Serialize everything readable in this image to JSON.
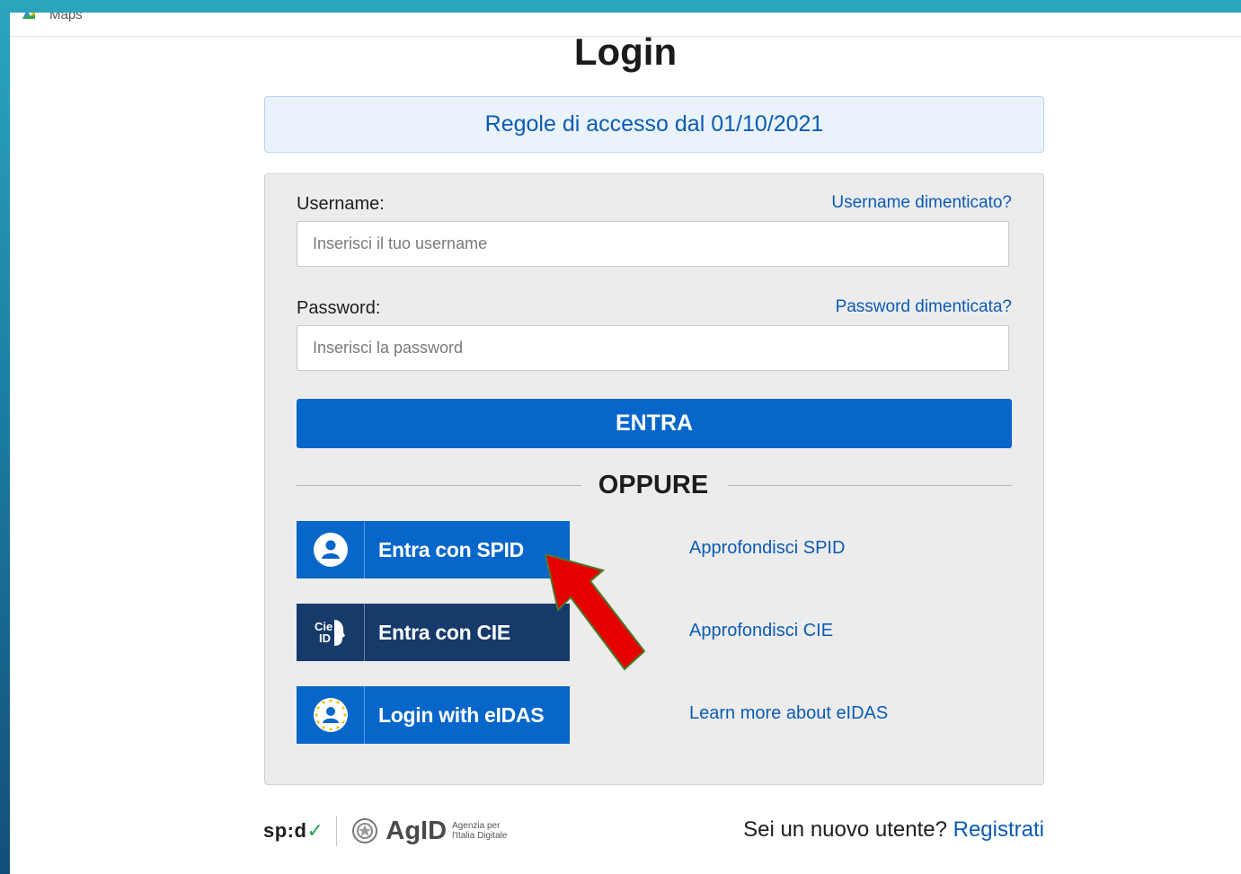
{
  "bookmark": {
    "label": "Maps",
    "icon": "maps-icon"
  },
  "page_title": "Login",
  "rules_link": "Regole di accesso dal 01/10/2021",
  "form": {
    "username_label": "Username:",
    "username_forgot": "Username dimenticato?",
    "username_placeholder": "Inserisci il tuo username",
    "username_value": "",
    "password_label": "Password:",
    "password_forgot": "Password dimenticata?",
    "password_placeholder": "Inserisci la password",
    "password_value": "",
    "submit_label": "ENTRA"
  },
  "separator_label": "OPPURE",
  "identity_options": [
    {
      "label": "Entra con SPID",
      "link": "Approfondisci SPID",
      "icon": "user-circle-icon",
      "color": "#0766c9"
    },
    {
      "label": "Entra con CIE",
      "link": "Approfondisci CIE",
      "icon": "cie-id-icon",
      "color": "#163b6b"
    },
    {
      "label": "Login with eIDAS",
      "link": "Learn more about eIDAS",
      "icon": "eu-stars-user-icon",
      "color": "#0766c9"
    }
  ],
  "footer": {
    "spid_logo": "sp:d",
    "agid_logo": "AgID",
    "agid_sub_line1": "Agenzia per",
    "agid_sub_line2": "l'Italia Digitale",
    "new_user_text": "Sei un nuovo utente?",
    "register_link": "Registrati"
  },
  "colors": {
    "accent": "#0766c9",
    "cie": "#163b6b",
    "link": "#0b5bb5",
    "annotation_arrow": "#e60000"
  }
}
